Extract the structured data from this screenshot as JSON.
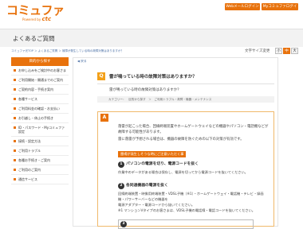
{
  "header": {
    "logo_text": "コミュファ",
    "logo_powered": "Powered by",
    "logo_brand": "ctc",
    "btn_mail": "Webメールログイン",
    "btn_mycommufa": "Myコミュファログイン"
  },
  "page_title": "よくあるご質問",
  "breadcrumb": "コミュファ光TOP ＞ よくあるご質問 ＞ 故障が発生している時の故障対策はありますか？",
  "font_size": {
    "label": "文字サイズ変更",
    "options": [
      "小",
      "中",
      "大"
    ],
    "active_index": 1
  },
  "sidebar": {
    "title": "目的から探す",
    "items": [
      "お申し込みをご検討中のお客さま",
      "ご利用開始・開通までのご案内",
      "ご契約内容・手続き案内",
      "各種サービス",
      "ご利用料金の確認・お支払い",
      "お引越し・休止の手続き",
      "ID・パスワード・Myコミュファ設定",
      "接続・設定方法",
      "ご利用トラブル",
      "各種お手続き・ご案内",
      "ご利用のご案内",
      "通信サービス"
    ]
  },
  "content": {
    "back_link": "◀ 戻る",
    "question_badge": "Q",
    "question": "雷が鳴っている時の故障対策はありますか？",
    "question_detail": "雷が鳴っている時の故障対策はありますか？",
    "category": "カテゴリー：　目的から探す　＞　ご利用トラブル・故障・機器・メンテナンス",
    "answer_badge": "A",
    "answer_para1": "落雷が起こった場合、回線終端装置やホームゲートウェイなどの機器やパソコン・電話機などが故障する可能性があります。",
    "answer_para2": "雷に落雷が予想される場合は、機器の故障を防ぐための以下の対策が有効です。",
    "highlight": "雷鳴が発生しそうな時にご注意いただく事",
    "step1_num": "1",
    "step1_title": "パソコンの電源を切り、電源コードを抜く",
    "step1_body": "作業中のデータがある場合は保存し、電源を切ってから電源コードを抜いてください。",
    "step2_num": "2",
    "step2_title": "各同通機器の電源を抜く",
    "step2_body1": "回線終端装置・映像用終端装置・VDSL子機（※1）・ホームゲートウェイ・電話機・テレビ・録画機・パワーサーバーなどの機器を",
    "step2_body2": "電源アダプター・電源コードから抜いてください。",
    "step2_note": "※1 マンションVタイプのお客さまは、VDSL子機の電話線・電話コードを抜いてください。",
    "step3_num": "3"
  },
  "colors": {
    "brand": "#e8720c",
    "q_badge": "#f3a019"
  }
}
